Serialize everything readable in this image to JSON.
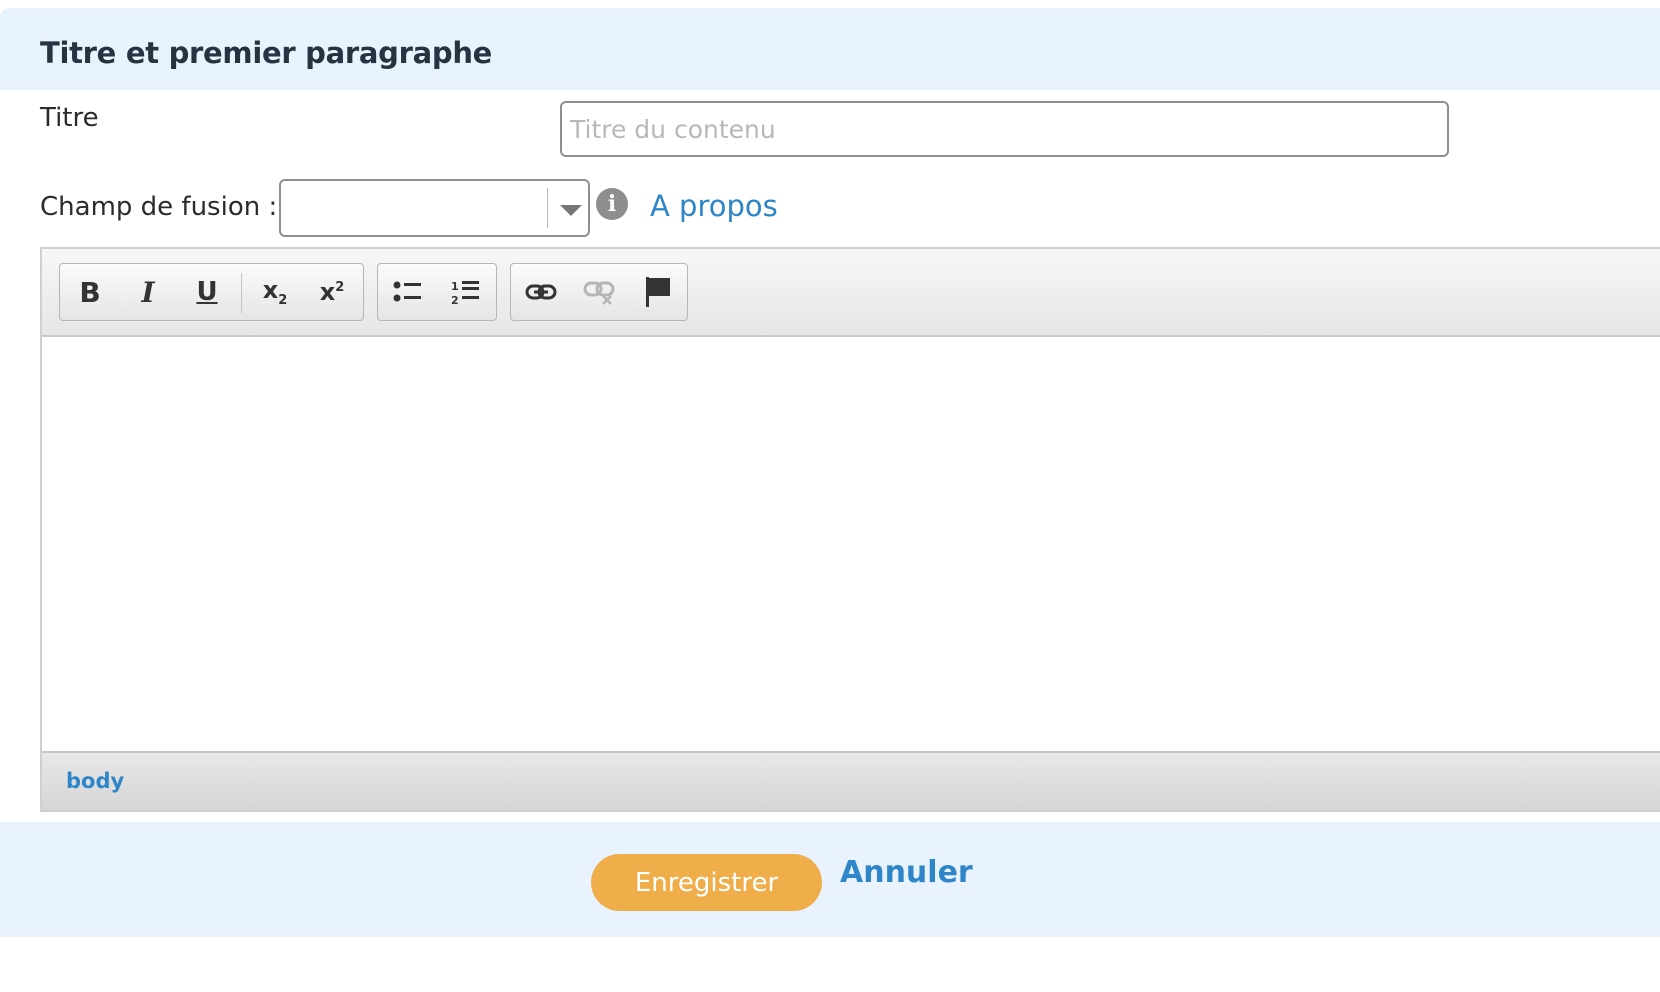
{
  "section": {
    "title": "Titre et premier paragraphe"
  },
  "form": {
    "title_label": "Titre",
    "title_placeholder": "Titre du contenu",
    "title_value": "",
    "merge_label": "Champ de fusion :",
    "merge_value": "",
    "about_link": "A propos"
  },
  "editor": {
    "toolbar": {
      "format_group": [
        {
          "label": "B",
          "icon": "bold-icon"
        },
        {
          "label": "I",
          "icon": "italic-icon"
        },
        {
          "label": "U",
          "icon": "underline-icon"
        },
        {
          "label": "x",
          "icon": "subscript-icon"
        },
        {
          "label": "x",
          "icon": "superscript-icon"
        }
      ],
      "list_group": [
        {
          "icon": "bulleted-list-icon"
        },
        {
          "icon": "numbered-list-icon"
        }
      ],
      "link_group": [
        {
          "icon": "link-icon"
        },
        {
          "icon": "unlink-icon",
          "disabled": true
        },
        {
          "icon": "anchor-flag-icon"
        }
      ]
    },
    "content": "",
    "status_path": "body"
  },
  "actions": {
    "save_label": "Enregistrer",
    "cancel_label": "Annuler"
  },
  "colors": {
    "header_bg": "#e8f3fd",
    "link": "#2e86c9",
    "save_button": "#f0ae4a"
  }
}
